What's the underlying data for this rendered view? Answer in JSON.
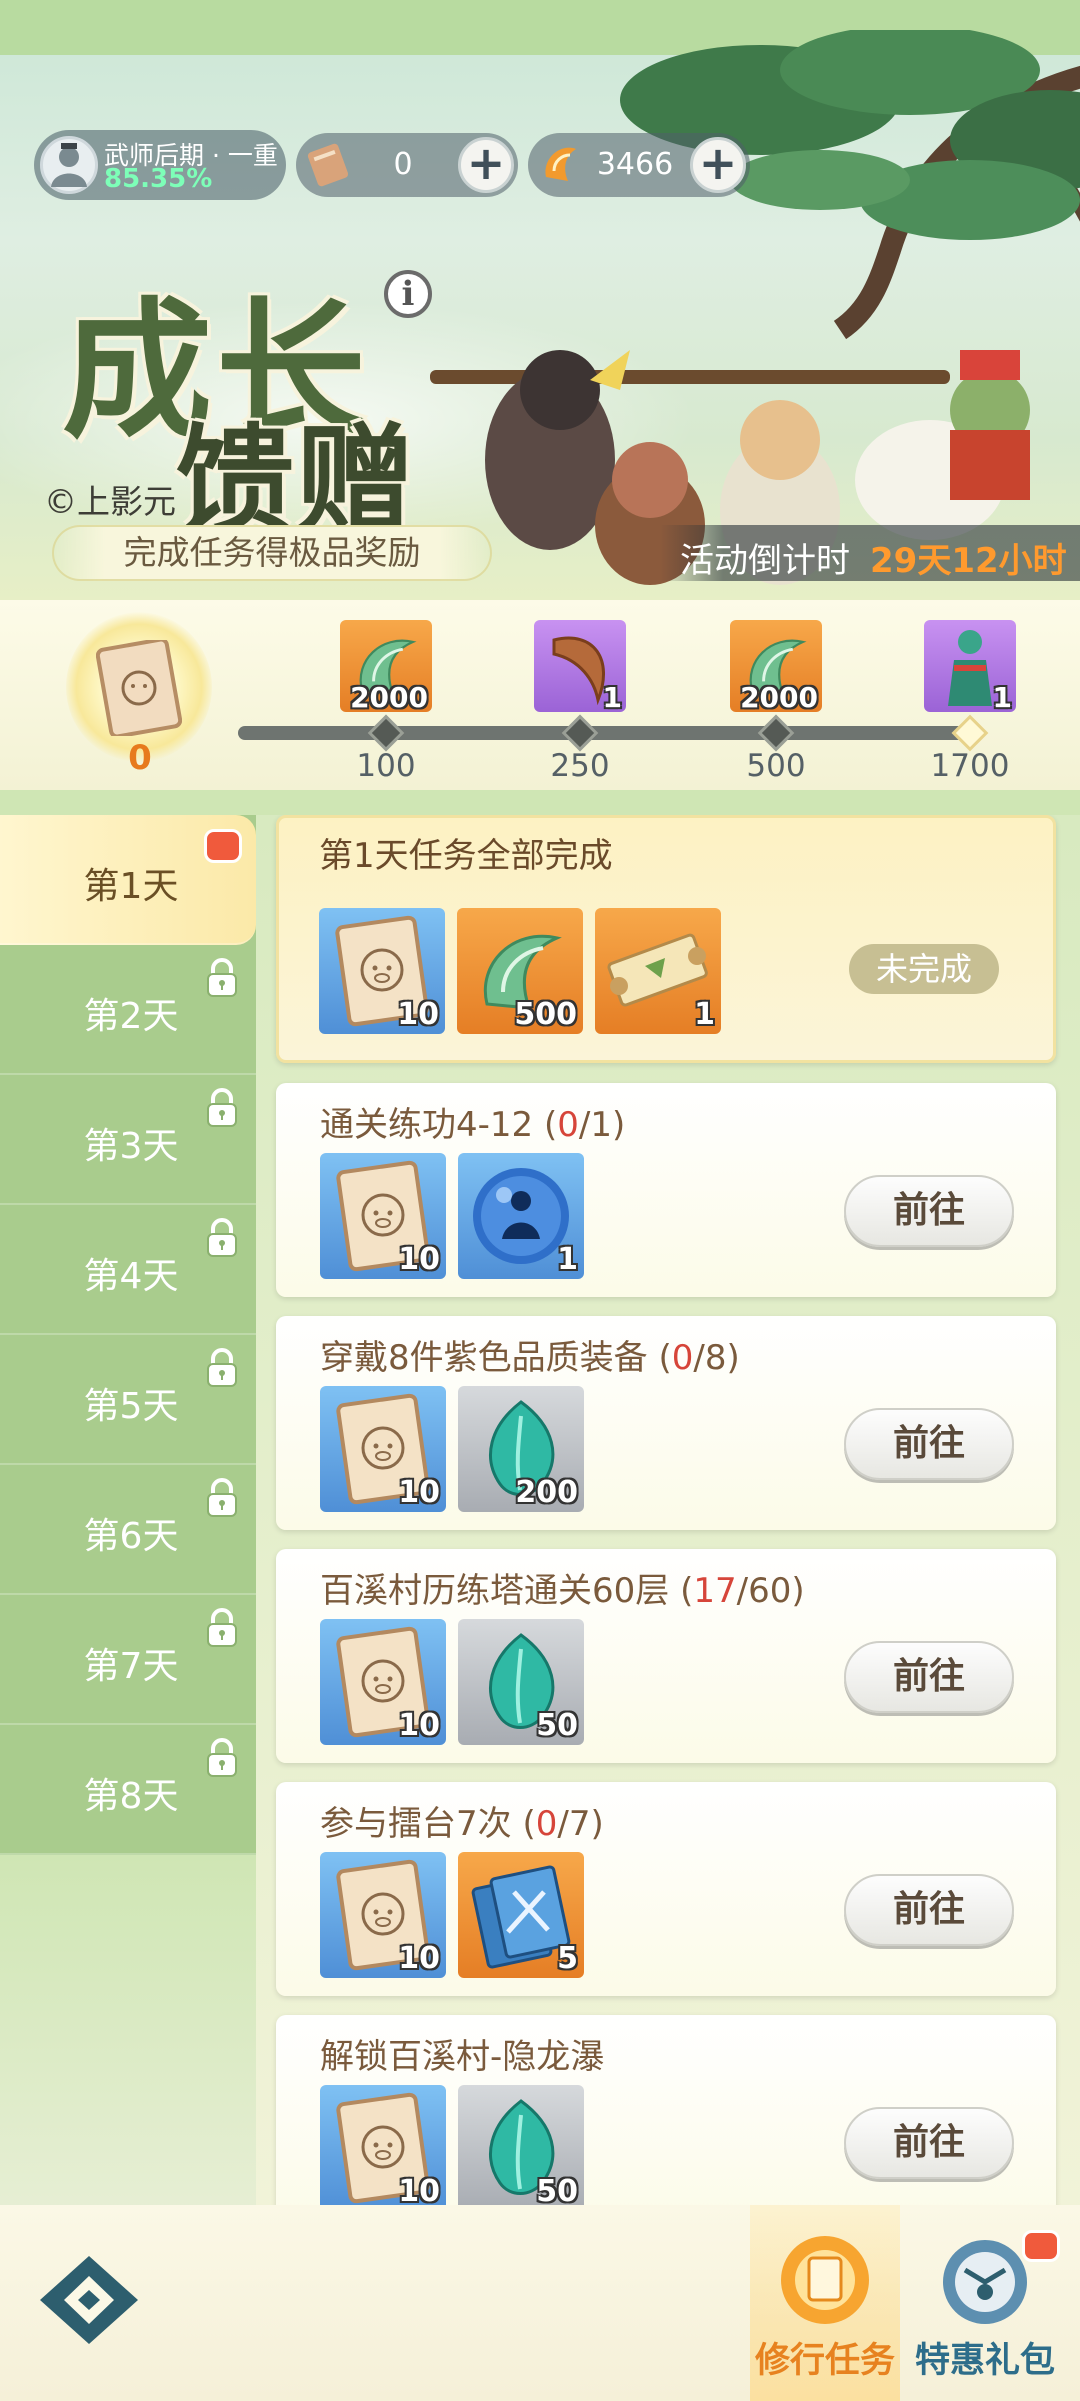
{
  "header": {
    "player": {
      "rank": "武师后期 · 一重",
      "percent": "85.35%"
    },
    "currencies": [
      {
        "icon": "scroll-ticket-icon",
        "value": "0"
      },
      {
        "icon": "gold-coin-icon",
        "value": "3466"
      }
    ],
    "title_main": "成长",
    "title_sub": "馈赠",
    "copyright": "©上影元",
    "ribbon": "完成任务得极品奖励",
    "countdown_label": "活动倒计时",
    "countdown_value": "29天12小时"
  },
  "progress": {
    "current": "0",
    "milestones": [
      {
        "points": "100",
        "reward_icon": "jade-icon",
        "qty": "2000",
        "bg": "orange"
      },
      {
        "points": "250",
        "reward_icon": "horn-icon",
        "qty": "1",
        "bg": "purple"
      },
      {
        "points": "500",
        "reward_icon": "jade-icon",
        "qty": "2000",
        "bg": "orange"
      },
      {
        "points": "1700",
        "reward_icon": "costume-icon",
        "qty": "1",
        "bg": "purple"
      }
    ]
  },
  "days": [
    {
      "label": "第1天",
      "locked": false,
      "active": true
    },
    {
      "label": "第2天",
      "locked": true
    },
    {
      "label": "第3天",
      "locked": true
    },
    {
      "label": "第4天",
      "locked": true
    },
    {
      "label": "第5天",
      "locked": true
    },
    {
      "label": "第6天",
      "locked": true
    },
    {
      "label": "第7天",
      "locked": true
    },
    {
      "label": "第8天",
      "locked": true
    }
  ],
  "summary": {
    "title": "第1天任务全部完成",
    "status": "未完成",
    "rewards": [
      {
        "icon": "pig-card-icon",
        "qty": "10",
        "bg": "blue"
      },
      {
        "icon": "jade-icon",
        "qty": "500",
        "bg": "orange"
      },
      {
        "icon": "scroll-icon",
        "qty": "1",
        "bg": "orange"
      }
    ]
  },
  "tasks": [
    {
      "title": "通关练功4-12 (",
      "done": "0",
      "total": "/1)",
      "button": "前往",
      "rewards": [
        {
          "icon": "pig-card-icon",
          "qty": "10",
          "bg": "blue"
        },
        {
          "icon": "spirit-orb-icon",
          "qty": "1",
          "bg": "blue"
        }
      ]
    },
    {
      "title": "穿戴8件紫色品质装备 (",
      "done": "0",
      "total": "/8)",
      "button": "前往",
      "rewards": [
        {
          "icon": "pig-card-icon",
          "qty": "10",
          "bg": "blue"
        },
        {
          "icon": "teal-gem-icon",
          "qty": "200",
          "bg": "grey"
        }
      ]
    },
    {
      "title": "百溪村历练塔通关60层 (",
      "done": "17",
      "total": "/60)",
      "button": "前往",
      "rewards": [
        {
          "icon": "pig-card-icon",
          "qty": "10",
          "bg": "blue"
        },
        {
          "icon": "teal-gem-icon",
          "qty": "50",
          "bg": "grey"
        }
      ]
    },
    {
      "title": "参与擂台7次 (",
      "done": "0",
      "total": "/7)",
      "button": "前往",
      "rewards": [
        {
          "icon": "pig-card-icon",
          "qty": "10",
          "bg": "blue"
        },
        {
          "icon": "sword-book-icon",
          "qty": "5",
          "bg": "orange"
        }
      ]
    },
    {
      "title": "解锁百溪村-隐龙瀑",
      "done": "",
      "total": "",
      "button": "前往",
      "rewards": [
        {
          "icon": "pig-card-icon",
          "qty": "10",
          "bg": "blue"
        },
        {
          "icon": "teal-gem-icon",
          "qty": "50",
          "bg": "grey"
        }
      ]
    }
  ],
  "nav": {
    "items": [
      {
        "label": "修行任务",
        "icon": "practice-task-icon",
        "active": true
      },
      {
        "label": "特惠礼包",
        "icon": "gift-pack-icon",
        "active": false
      }
    ]
  },
  "colors": {
    "accent": "#e7821f",
    "progress_red": "#d6453a",
    "sidebar": "#a9cc8d"
  }
}
